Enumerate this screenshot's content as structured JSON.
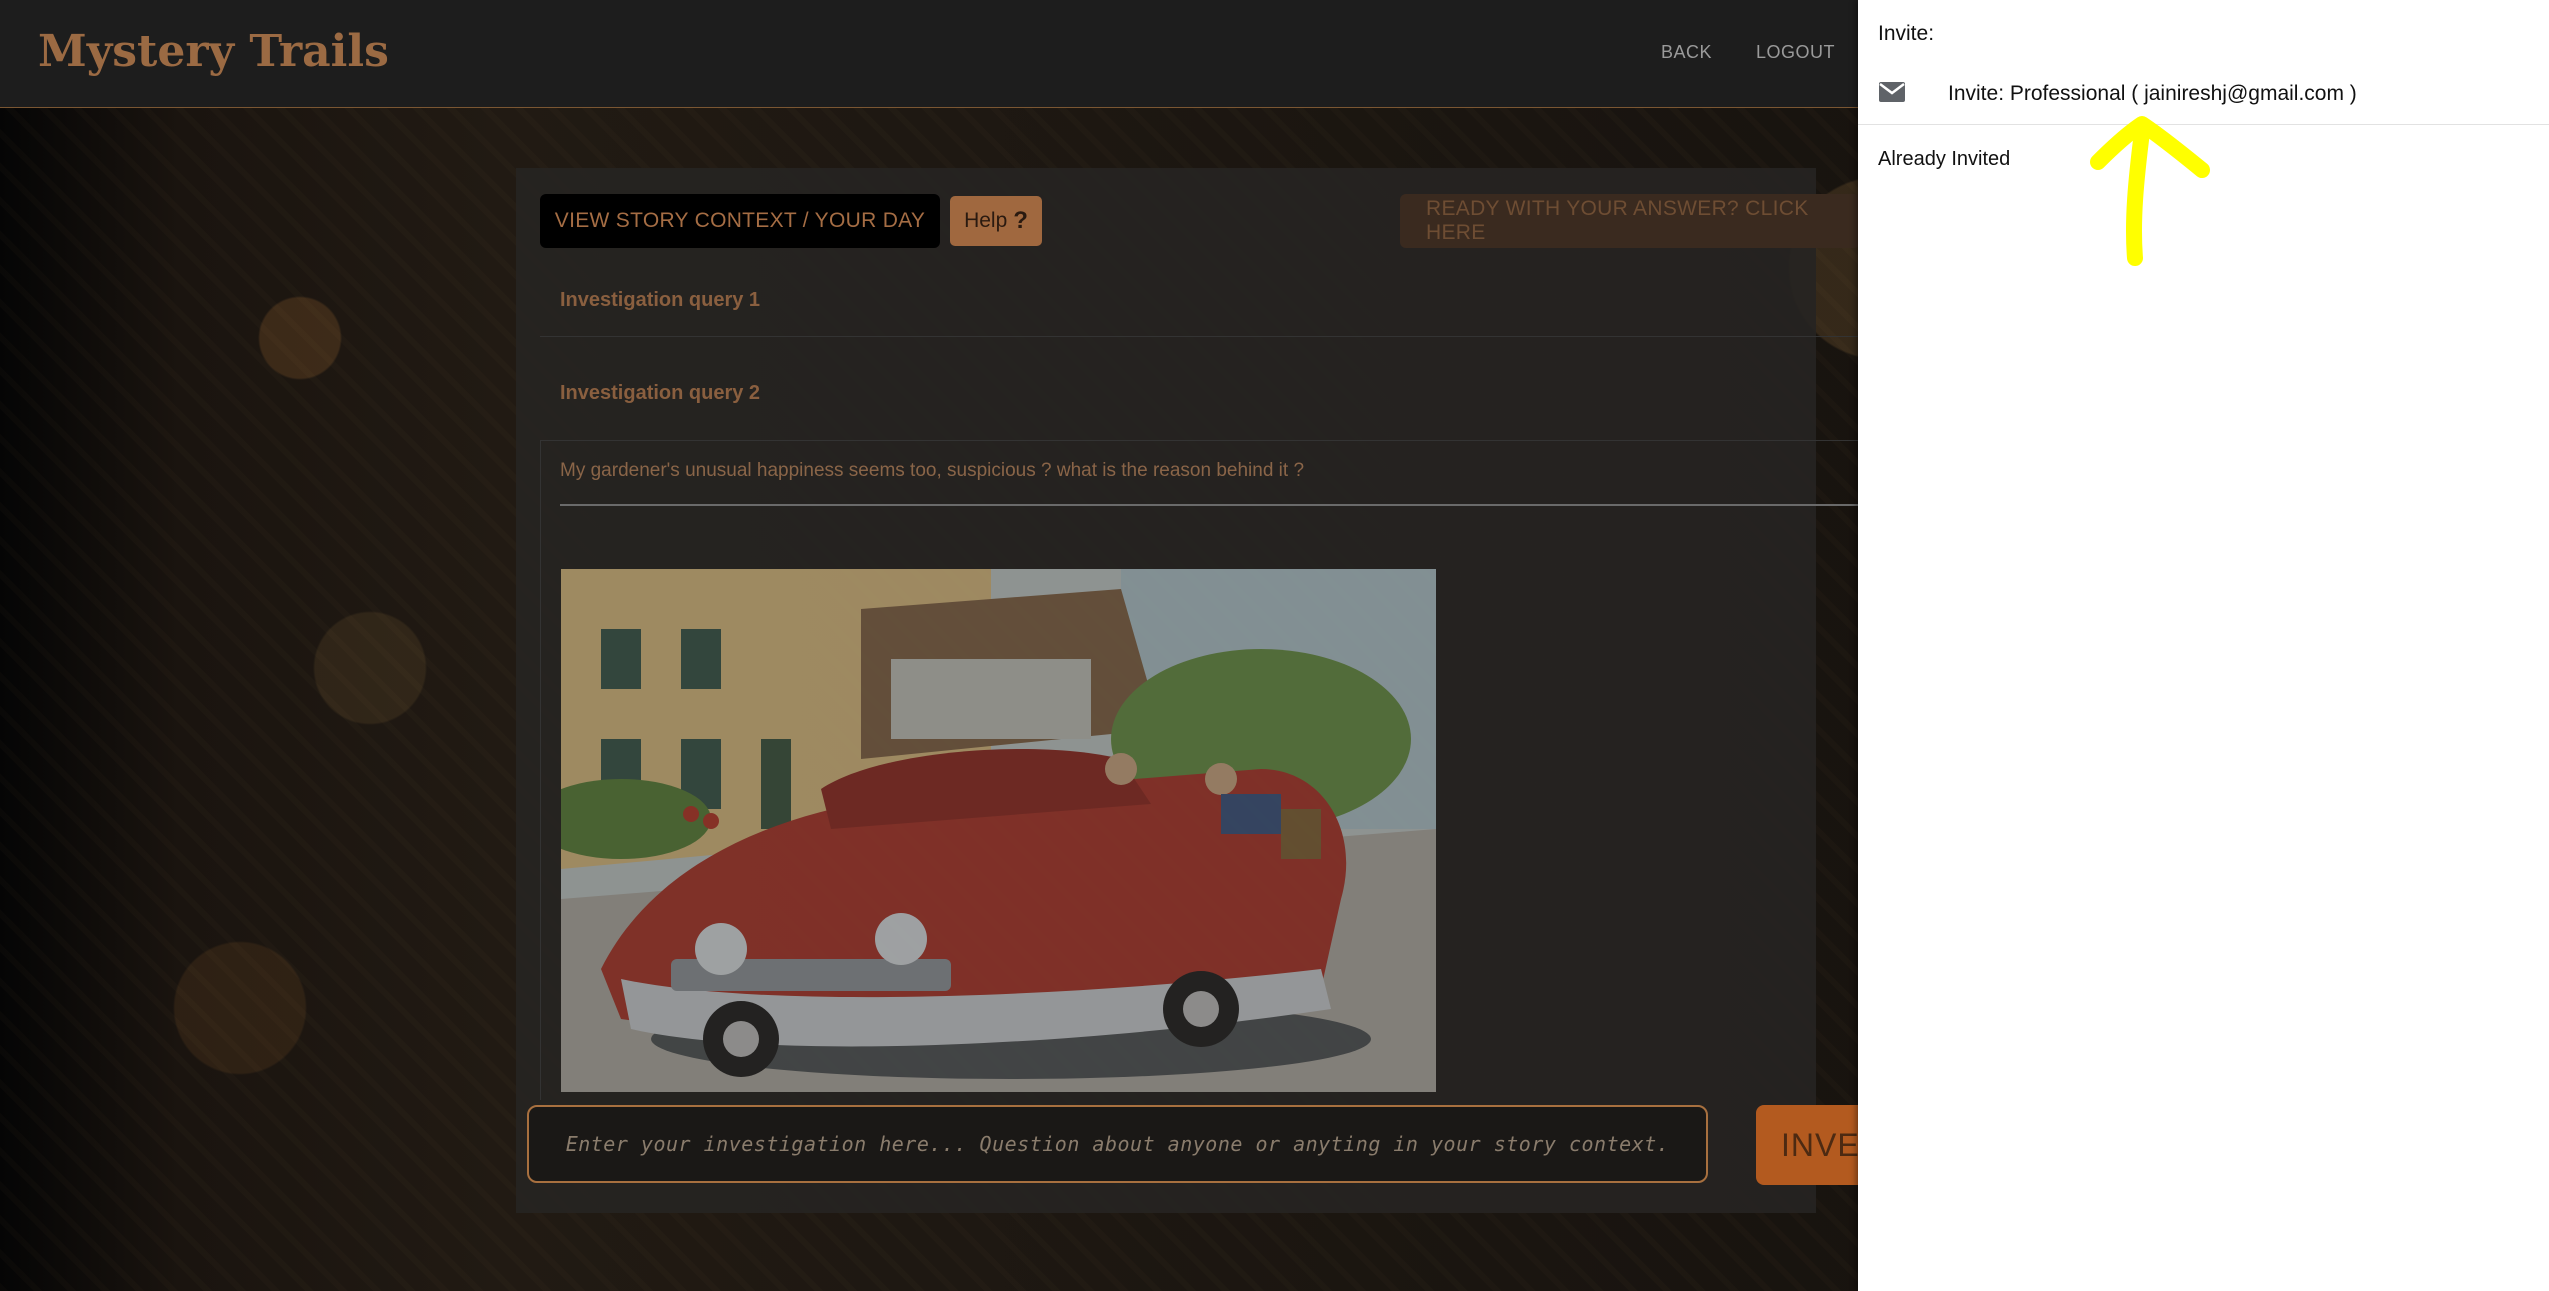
{
  "header": {
    "brand": "Mystery Trails",
    "nav": {
      "back": "BACK",
      "logout": "LOGOUT"
    }
  },
  "toolbar": {
    "context_label": "VIEW STORY CONTEXT / YOUR DAY",
    "help_label": "Help",
    "help_icon": "?",
    "ready_label": "READY WITH YOUR ANSWER? CLICK HERE"
  },
  "queries": [
    {
      "title": "Investigation query 1"
    },
    {
      "title": "Investigation query 2"
    }
  ],
  "answer": {
    "text": "My gardener's unusual happiness seems too, suspicious ? what is the reason behind it ?"
  },
  "input": {
    "placeholder": "Enter your investigation here... Question about anyone or anyting in your story context.",
    "value": ""
  },
  "submit": {
    "label": "INVESTIGATE"
  },
  "drawer": {
    "title": "Invite:",
    "invite_label": "Invite: Professional ( jainireshj@gmail.com )",
    "status": "Already Invited",
    "icon": "mail-icon"
  },
  "colors": {
    "accent": "#a0683f",
    "brand": "#9b6a43",
    "annotation": "#ffff00",
    "investigate": "#b35a1f"
  }
}
